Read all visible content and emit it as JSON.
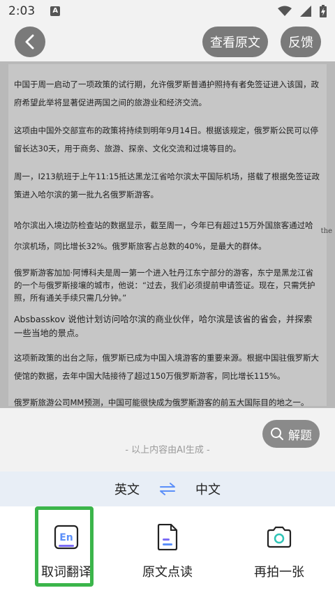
{
  "status_bar": {
    "time": "2:03",
    "notification_letter": "A"
  },
  "header": {
    "view_original_label": "查看原文",
    "feedback_label": "反馈"
  },
  "document": {
    "paragraphs": [
      "中国于周一启动了一项政策的试行期，允许俄罗斯普通护照持有者免签证进入该国，政府希望此举将显著促进两国之间的旅游业和经济交流。",
      "这项由中国外交部宣布的政策将持续到明年9月14日。根据该规定，俄罗斯公民可以停留长达30天，用于商务、旅游、探亲、文化交流和过境等目的。",
      "周一，I213航班于上午11:15抵达黑龙江省哈尔滨太平国际机场，搭载了根据免签证政策进入哈尔滨的第一批九名俄罗斯游客。",
      "哈尔滨出入境边防检查站的数据显示，截至周一，今年已有超过15万外国旅客通过哈尔滨机场，同比增长32%。俄罗斯旅客占总数的40%，是最大的群体。",
      "俄罗斯游客加加·阿博科夫是周一第一个进入牡丹江东宁部分的游客，东宁是黑龙江省的一个与俄罗斯接壤的城市，他说：“过去，我们必须提前申请签证。现在，只需凭护照，所有通关手续只需几分钟。”",
      "Absbasskov 说他计划访问哈尔滨的商业伙伴，哈尔滨是该省的省会，并探索一些当地的景点。",
      "这项新政策的出台之际，俄罗斯已成为中国入境游客的重要来源。根据中国驻俄罗斯大使馆的数据，去年中国大陆接待了超过150万俄罗斯游客，同比增长115%。",
      "俄罗斯旅游公司MM预测，中国可能很快成为俄罗斯游客的前五大国际目的地之一。"
    ],
    "side_mark": "the"
  },
  "solve_button_label": "解题",
  "ai_note": "- 以上内容由AI生成 -",
  "language_bar": {
    "source": "英文",
    "target": "中文"
  },
  "toolbar": {
    "word_translate_label": "取词翻译",
    "read_original_label": "原文点读",
    "retake_label": "再拍一张",
    "word_icon_text": "En"
  },
  "colors": {
    "highlight": "#3bb54a",
    "accent_blue": "#5b8ff9",
    "icon_purple": "#7b6cf6",
    "icon_teal": "#2ec4b6"
  }
}
